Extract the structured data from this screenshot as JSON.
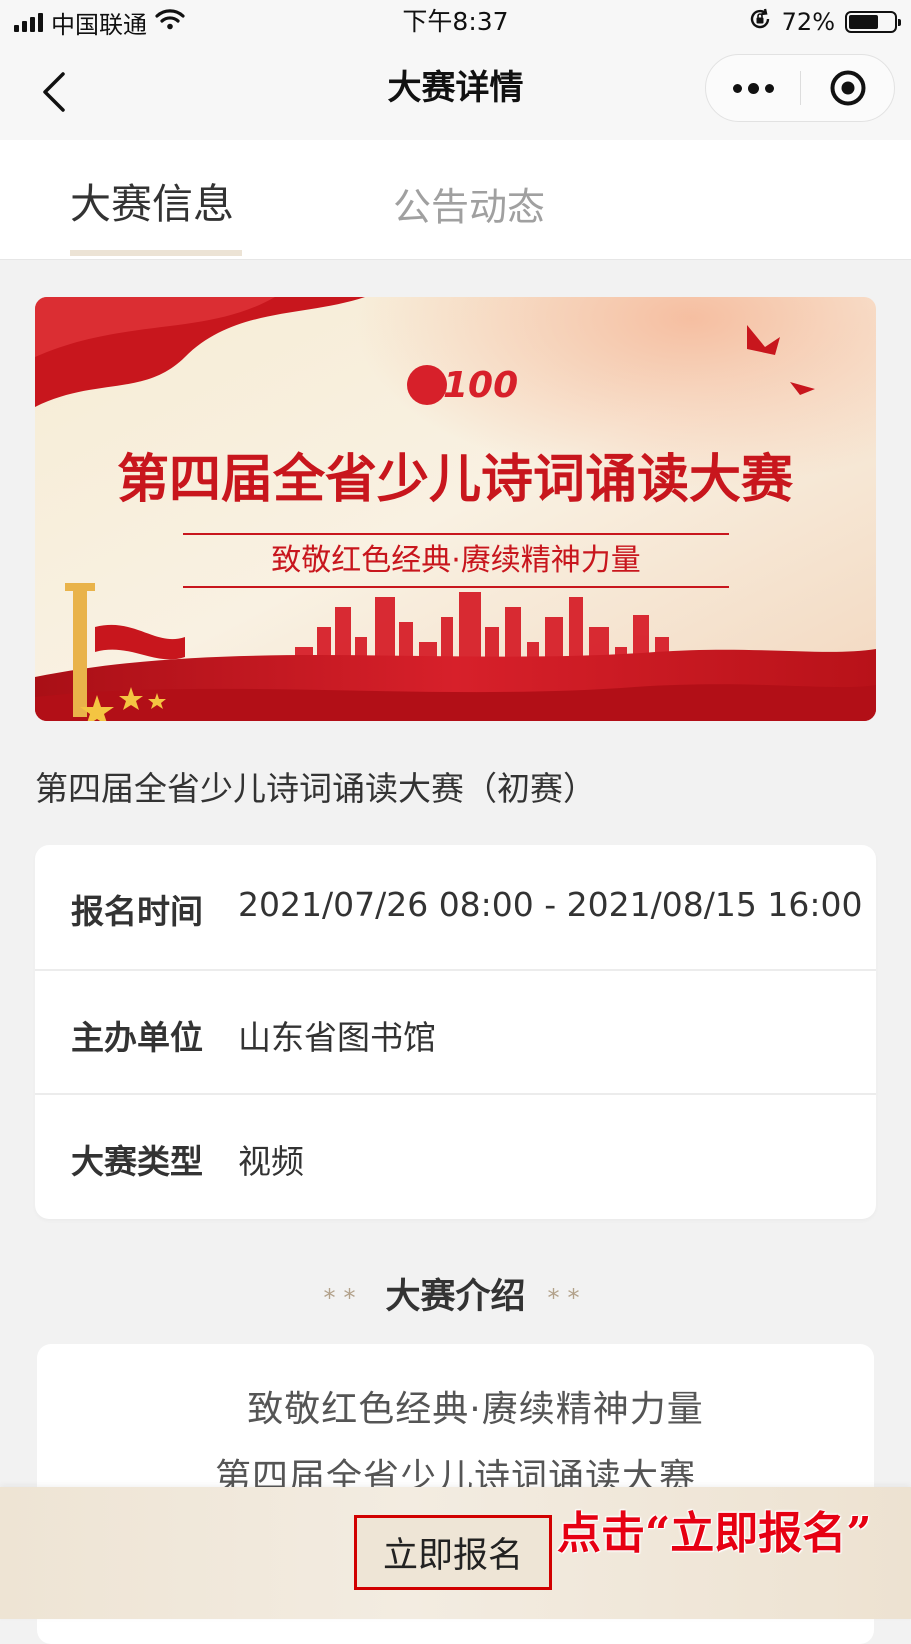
{
  "status_bar": {
    "carrier": "中国联通",
    "time": "下午8:37",
    "battery_text": "72%",
    "battery_level": 0.72
  },
  "nav": {
    "title": "大赛详情",
    "back_icon": "chevron-left-icon",
    "more_icon": "more-dots-icon",
    "close_icon": "target-circle-icon"
  },
  "tabs": [
    {
      "label": "大赛信息",
      "active": true
    },
    {
      "label": "公告动态",
      "active": false
    }
  ],
  "banner": {
    "emblem_text": "100",
    "title": "第四届全省少儿诗词诵读大赛",
    "subtitle": "致敬红色经典·赓续精神力量"
  },
  "contest_name": "第四届全省少儿诗词诵读大赛（初赛）",
  "info": [
    {
      "label": "报名时间",
      "value": "2021/07/26 08:00 - 2021/08/15 16:00"
    },
    {
      "label": "主办单位",
      "value": "山东省图书馆"
    },
    {
      "label": "大赛类型",
      "value": "视频"
    }
  ],
  "intro": {
    "section_title": "大赛介绍",
    "stars": "**",
    "lines": [
      "致敬红色经典·赓续精神力量",
      "第四届全省少儿诗词诵读大赛"
    ]
  },
  "bottom": {
    "signup_label": "立即报名",
    "annotation": "点击“立即报名”"
  },
  "colors": {
    "accent_red": "#e60012",
    "banner_red": "#c8161d",
    "tab_underline": "#ece3d5",
    "star_color": "#b3a28b"
  }
}
